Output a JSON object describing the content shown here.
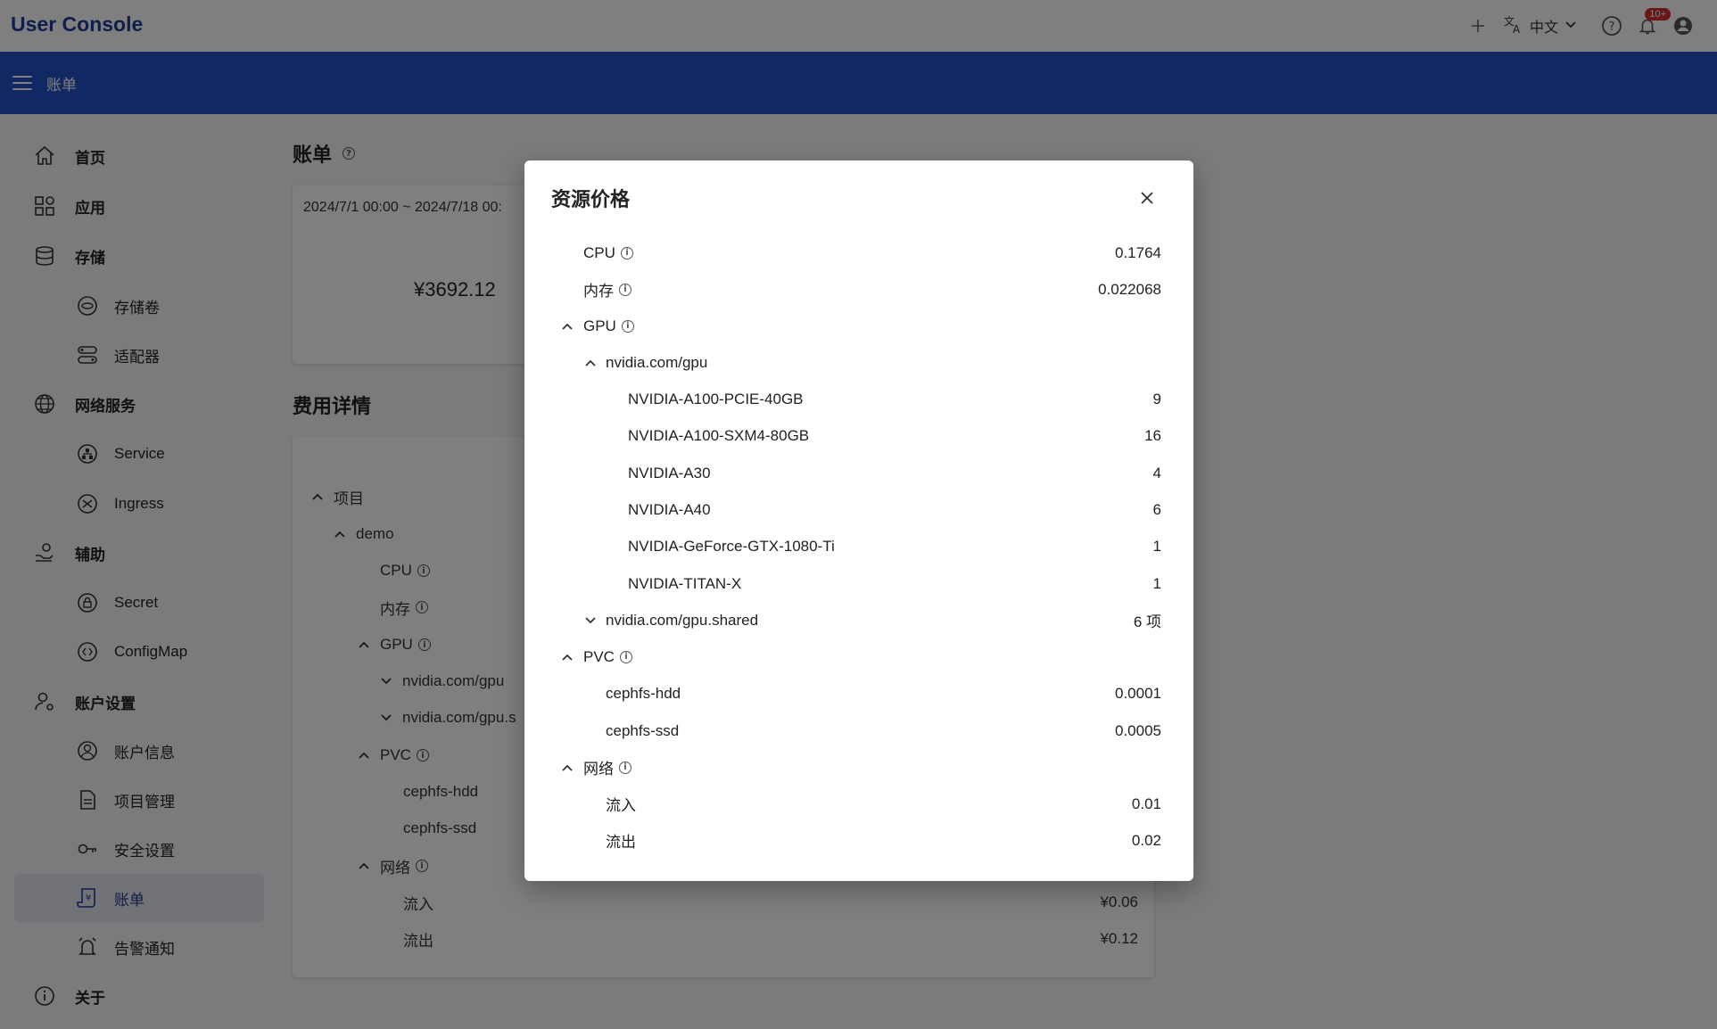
{
  "app": {
    "brand": "User Console",
    "lang": "中文",
    "notif_badge": "10+",
    "page_header": "账单"
  },
  "sidebar": {
    "items": [
      {
        "label": "首页",
        "icon": "home-icon"
      },
      {
        "label": "应用",
        "icon": "apps-icon"
      },
      {
        "label": "存储",
        "icon": "database-icon"
      },
      {
        "label": "存储卷",
        "icon": "volume-icon"
      },
      {
        "label": "适配器",
        "icon": "adapter-icon"
      },
      {
        "label": "网络服务",
        "icon": "globe-icon"
      },
      {
        "label": "Service",
        "icon": "service-icon"
      },
      {
        "label": "Ingress",
        "icon": "ingress-icon"
      },
      {
        "label": "辅助",
        "icon": "helper-icon"
      },
      {
        "label": "Secret",
        "icon": "secret-icon"
      },
      {
        "label": "ConfigMap",
        "icon": "configmap-icon"
      },
      {
        "label": "账户设置",
        "icon": "user-settings-icon"
      },
      {
        "label": "账户信息",
        "icon": "account-icon"
      },
      {
        "label": "项目管理",
        "icon": "document-icon"
      },
      {
        "label": "安全设置",
        "icon": "key-icon"
      },
      {
        "label": "账单",
        "icon": "bill-icon"
      },
      {
        "label": "告警通知",
        "icon": "alarm-icon"
      },
      {
        "label": "关于",
        "icon": "info-icon"
      }
    ]
  },
  "main": {
    "title": "账单",
    "date_range": "2024/7/1 00:00 ~ 2024/7/18 00:",
    "total": "¥3692.12",
    "details_title": "费用详情",
    "tree": [
      {
        "label": "项目"
      },
      {
        "label": "demo"
      },
      {
        "label": "CPU"
      },
      {
        "label": "内存"
      },
      {
        "label": "GPU"
      },
      {
        "label": "nvidia.com/gpu"
      },
      {
        "label": "nvidia.com/gpu.s"
      },
      {
        "label": "PVC"
      },
      {
        "label": "cephfs-hdd"
      },
      {
        "label": "cephfs-ssd"
      },
      {
        "label": "网络"
      },
      {
        "label": "流入",
        "amount": "¥0.06"
      },
      {
        "label": "流出",
        "amount": "¥0.12"
      }
    ]
  },
  "dialog": {
    "title": "资源价格",
    "rows": [
      {
        "name": "CPU",
        "value": "0.1764"
      },
      {
        "name": "内存",
        "value": "0.022068"
      },
      {
        "name": "GPU",
        "value": ""
      },
      {
        "name": "nvidia.com/gpu",
        "value": ""
      },
      {
        "name": "NVIDIA-A100-PCIE-40GB",
        "value": "9"
      },
      {
        "name": "NVIDIA-A100-SXM4-80GB",
        "value": "16"
      },
      {
        "name": "NVIDIA-A30",
        "value": "4"
      },
      {
        "name": "NVIDIA-A40",
        "value": "6"
      },
      {
        "name": "NVIDIA-GeForce-GTX-1080-Ti",
        "value": "1"
      },
      {
        "name": "NVIDIA-TITAN-X",
        "value": "1"
      },
      {
        "name": "nvidia.com/gpu.shared",
        "value": "6 项"
      },
      {
        "name": "PVC",
        "value": ""
      },
      {
        "name": "cephfs-hdd",
        "value": "0.0001"
      },
      {
        "name": "cephfs-ssd",
        "value": "0.0005"
      },
      {
        "name": "网络",
        "value": ""
      },
      {
        "name": "流入",
        "value": "0.01"
      },
      {
        "name": "流出",
        "value": "0.02"
      }
    ]
  }
}
